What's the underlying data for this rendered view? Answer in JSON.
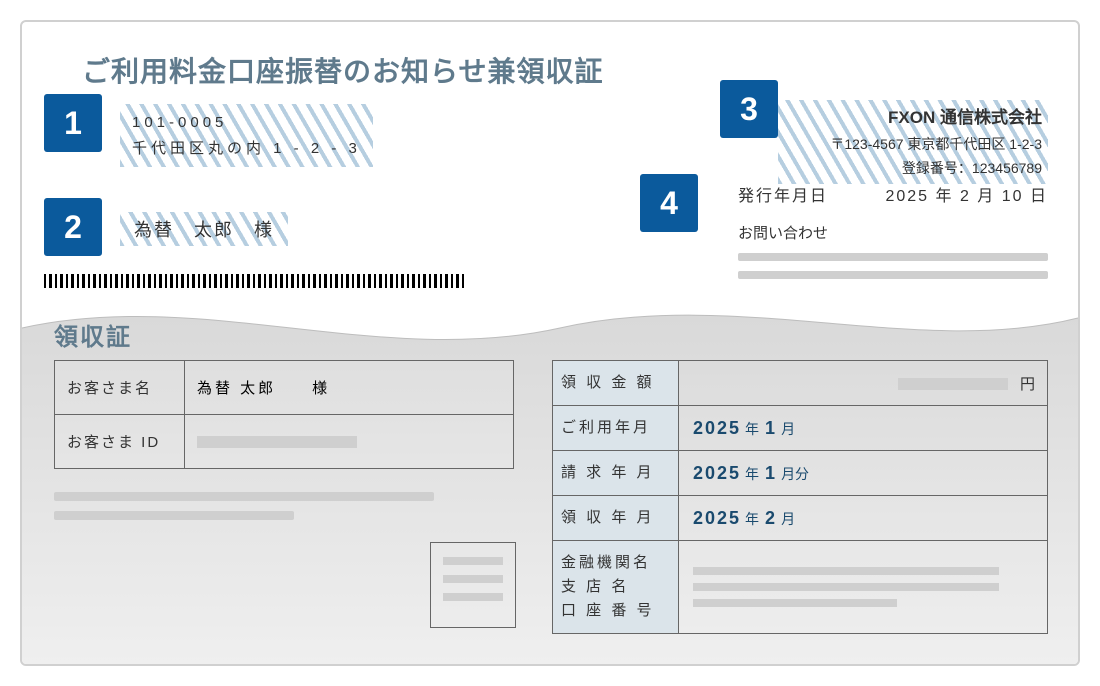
{
  "title": "ご利用料金口座振替のお知らせ兼領収証",
  "markers": {
    "m1": "1",
    "m2": "2",
    "m3": "3",
    "m4": "4"
  },
  "customer": {
    "postal": "101-0005",
    "address": "千代田区丸の内 1 - 2 - 3",
    "name": "為替　太郎　様"
  },
  "company": {
    "name": "FXON 通信株式会社",
    "postal": "〒123-4567",
    "address": "東京都千代田区 1-2-3",
    "reg_label": "登録番号：",
    "reg_no": "123456789"
  },
  "issue": {
    "label": "発行年月日",
    "date": "2025 年 2 月 10 日"
  },
  "inquiry_label": "お問い合わせ",
  "receipt": {
    "heading": "領収証",
    "cust_name_label": "お客さま名",
    "cust_name": "為替 太郎　　様",
    "cust_id_label": "お客さま ID"
  },
  "right_table": {
    "amount_label": "領 収 金 額",
    "yen": "円",
    "usage_label": "ご利用年月",
    "billing_label": "請 求 年 月",
    "receipt_label": "領 収 年 月",
    "bank_label": "金融機関名\n支 店 名\n口 座 番 号",
    "usage_year": "2025",
    "usage_month": "1",
    "billing_year": "2025",
    "billing_month": "1",
    "receipt_year": "2025",
    "receipt_month": "2",
    "unit_year": "年",
    "unit_month": "月",
    "unit_monthbun": "月分"
  }
}
